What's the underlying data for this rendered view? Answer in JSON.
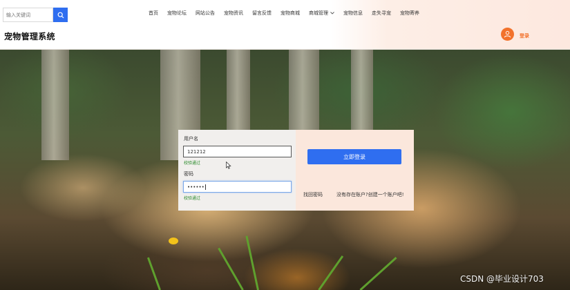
{
  "header": {
    "search_placeholder": "输入关键词",
    "search_icon": "search-icon",
    "nav": [
      {
        "label": "首页"
      },
      {
        "label": "宠物论坛"
      },
      {
        "label": "网站公告"
      },
      {
        "label": "宠物资讯"
      },
      {
        "label": "留言反馈"
      },
      {
        "label": "宠物商城"
      },
      {
        "label": "商城管理",
        "has_dropdown": true
      },
      {
        "label": "宠物信息"
      },
      {
        "label": "走失寻宠"
      },
      {
        "label": "宠物寄养"
      }
    ],
    "site_title": "宠物管理系统",
    "login_label": "登录",
    "avatar_icon": "user-icon",
    "accent_color": "#f2722c"
  },
  "login_form": {
    "username_label": "用户名",
    "username_value": "121212",
    "username_valid_msg": "校验通过",
    "password_label": "密码",
    "password_value": "••••••",
    "password_valid_msg": "校验通过",
    "submit_label": "立即登录",
    "forgot_link": "找回密码",
    "register_link": "没有存在账户?创建一个账户吧!",
    "primary_color": "#2f6ef0"
  },
  "watermark": "CSDN @毕业设计703"
}
